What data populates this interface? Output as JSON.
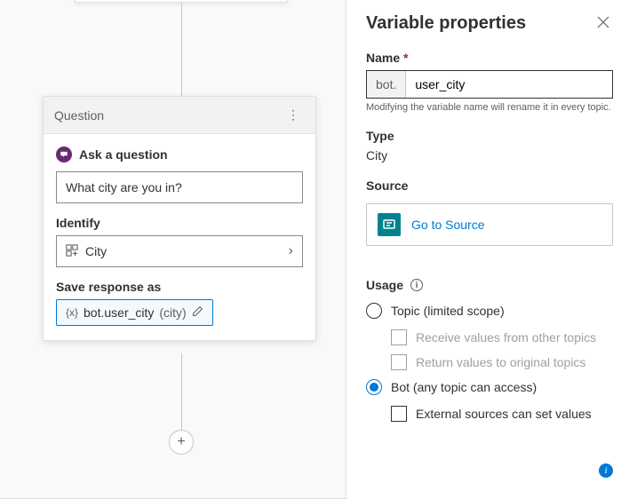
{
  "card": {
    "header": "Question",
    "ask_label": "Ask a question",
    "question_text": "What city are you in?",
    "identify_label": "Identify",
    "identify_value": "City",
    "save_label": "Save response as",
    "var_brace": "{x}",
    "var_name": "bot.user_city",
    "var_type_paren": "(city)"
  },
  "panel": {
    "title": "Variable properties",
    "name_label": "Name",
    "name_prefix": "bot.",
    "name_value": "user_city",
    "name_help": "Modifying the variable name will rename it in every topic.",
    "type_label": "Type",
    "type_value": "City",
    "source_label": "Source",
    "source_link": "Go to Source",
    "usage_label": "Usage",
    "topic_scope": "Topic (limited scope)",
    "receive": "Receive values from other topics",
    "return": "Return values to original topics",
    "bot_scope": "Bot (any topic can access)",
    "external": "External sources can set values"
  }
}
